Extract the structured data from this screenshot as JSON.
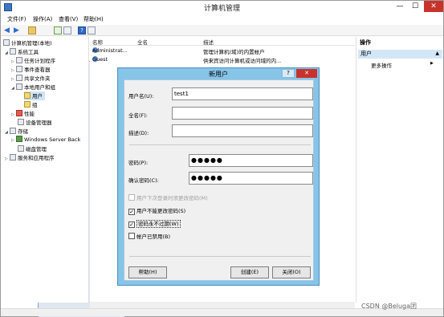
{
  "window": {
    "title": "计算机管理",
    "controls": {
      "minimize": "—",
      "maximize": "☐",
      "close": "✕"
    }
  },
  "menu": [
    "文件(F)",
    "操作(A)",
    "查看(V)",
    "帮助(H)"
  ],
  "toolbar": {
    "help_glyph": "?"
  },
  "tree": [
    {
      "label": "计算机管理(本地)",
      "level": 0,
      "expander": ""
    },
    {
      "label": "系统工具",
      "level": 1,
      "expander": "◢"
    },
    {
      "label": "任务计划程序",
      "level": 2,
      "expander": "▷"
    },
    {
      "label": "事件查看器",
      "level": 2,
      "expander": "▷"
    },
    {
      "label": "共享文件夹",
      "level": 2,
      "expander": "▷"
    },
    {
      "label": "本地用户和组",
      "level": 2,
      "expander": "◢"
    },
    {
      "label": "用户",
      "level": 3,
      "expander": "",
      "selected": true
    },
    {
      "label": "组",
      "level": 3,
      "expander": ""
    },
    {
      "label": "性能",
      "level": 2,
      "expander": "▷"
    },
    {
      "label": "设备管理器",
      "level": 2,
      "expander": ""
    },
    {
      "label": "存储",
      "level": 1,
      "expander": "◢"
    },
    {
      "label": "Windows Server Back",
      "level": 2,
      "expander": "▷"
    },
    {
      "label": "磁盘管理",
      "level": 2,
      "expander": ""
    },
    {
      "label": "服务和应用程序",
      "level": 1,
      "expander": "▷"
    }
  ],
  "list": {
    "columns": [
      "名称",
      "全名",
      "描述"
    ],
    "rows": [
      {
        "name": "Administrat...",
        "fullname": "",
        "desc": "管理计算机(域)的内置帐户"
      },
      {
        "name": "Guest",
        "fullname": "",
        "desc": "供来宾访问计算机或访问域的内..."
      }
    ]
  },
  "actions": {
    "header": "操作",
    "section": "用户",
    "section_arrow": "▲",
    "more": "更多操作",
    "more_arrow": "▶"
  },
  "dialog": {
    "title": "新用户",
    "help": "?",
    "close": "✕",
    "username_label": "用户名(U):",
    "username_value": "test1",
    "fullname_label": "全名(F):",
    "fullname_value": "",
    "desc_label": "描述(D):",
    "desc_value": "",
    "password_label": "密码(P):",
    "password_value": "●●●●●",
    "confirm_label": "确认密码(C):",
    "confirm_value": "●●●●●",
    "checkboxes": [
      {
        "label": "用户下次登录时须更改密码(M)",
        "checked": false,
        "disabled": true
      },
      {
        "label": "用户不能更改密码(S)",
        "checked": true,
        "disabled": false
      },
      {
        "label": "密码永不过期(W)",
        "checked": true,
        "disabled": false
      },
      {
        "label": "帐户已禁用(B)",
        "checked": false,
        "disabled": false
      }
    ],
    "check_glyph": "✓",
    "help_button": "帮助(H)",
    "create_button": "创建(E)",
    "close_button": "关闭(O)"
  },
  "watermark": "CSDN @Beluga团"
}
